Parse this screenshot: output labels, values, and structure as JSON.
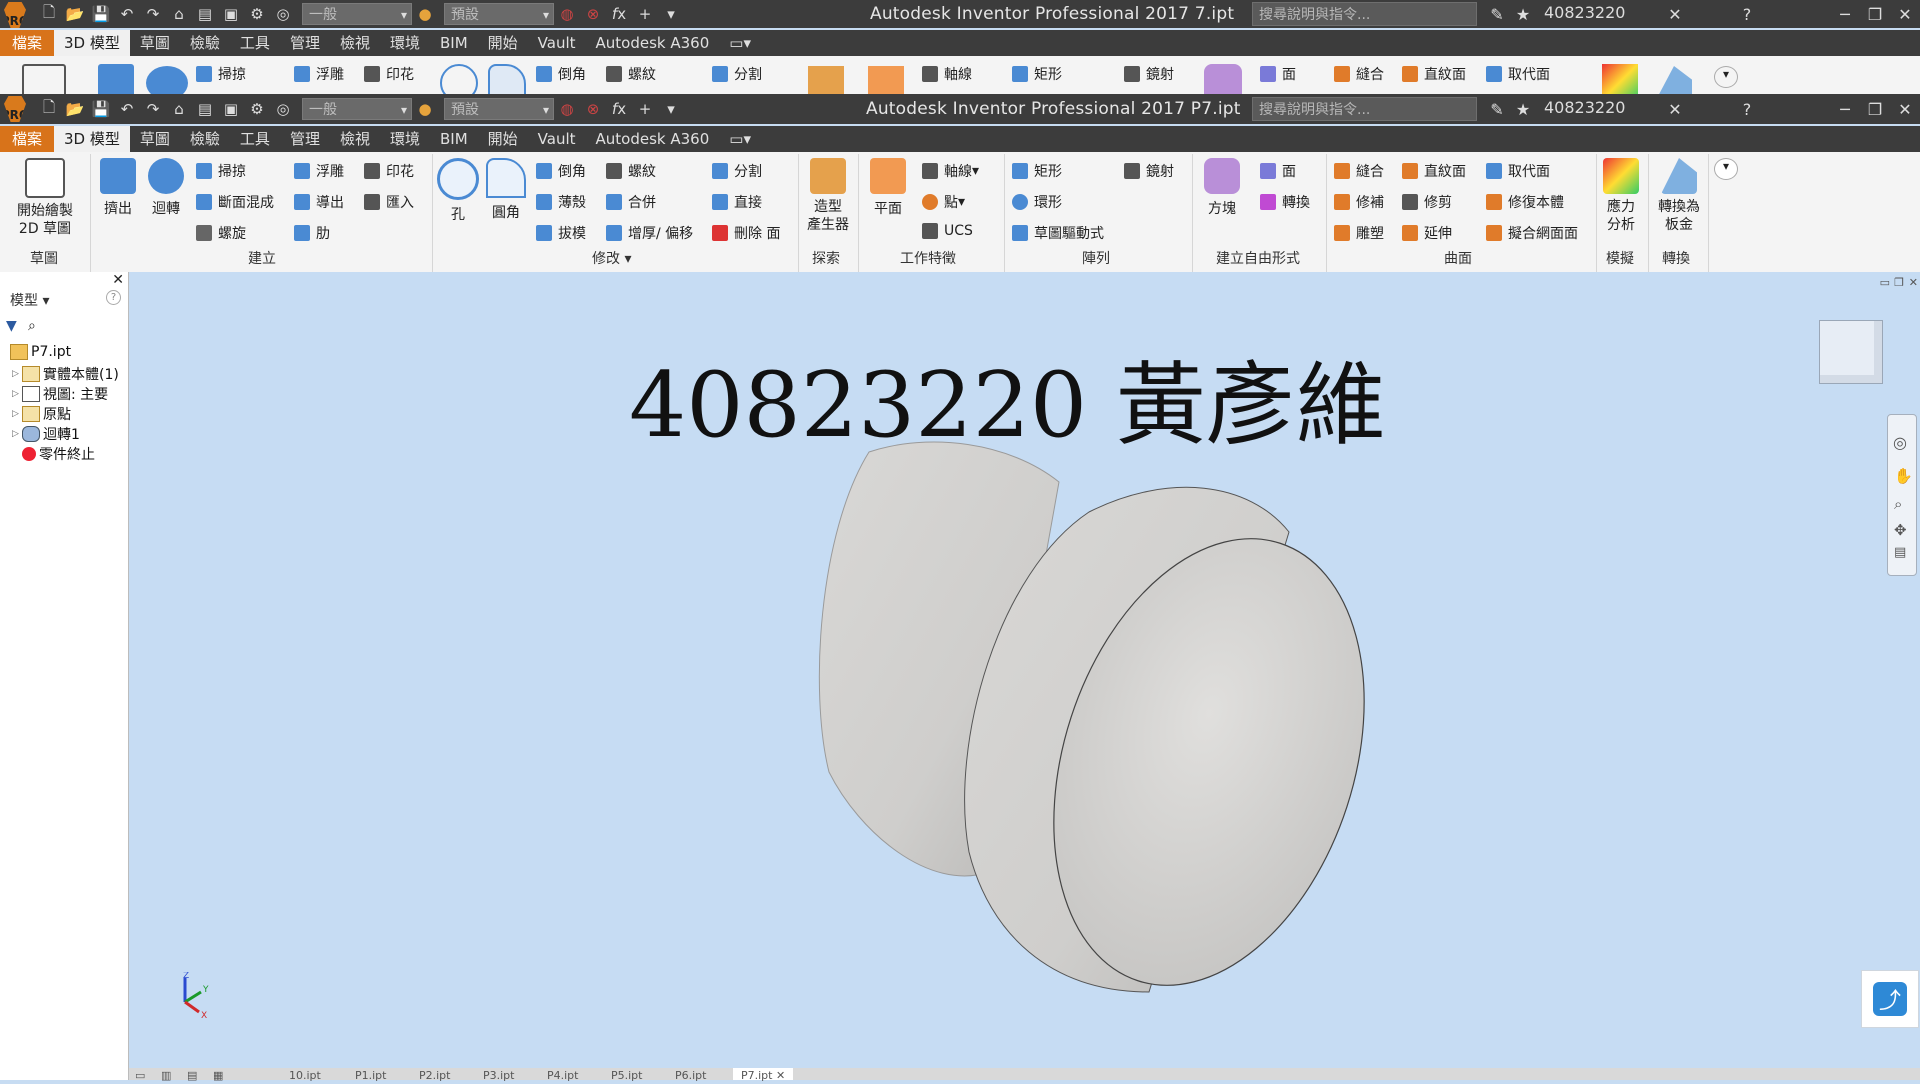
{
  "app": {
    "title_top": "Autodesk Inventor Professional 2017    7.ipt",
    "title_bottom": "Autodesk Inventor Professional 2017    P7.ipt",
    "search_placeholder": "搜尋說明與指令...",
    "user": "40823220",
    "style_dropdown": "一般",
    "appearance_dropdown": "預設"
  },
  "menu_tabs": [
    "檔案",
    "3D 模型",
    "草圖",
    "檢驗",
    "工具",
    "管理",
    "檢視",
    "環境",
    "BIM",
    "開始",
    "Vault",
    "Autodesk A360"
  ],
  "ribbon": {
    "sketch": {
      "btn": "開始繪製\n2D 草圖",
      "panel": "草圖"
    },
    "create": {
      "extrude": "擠出",
      "revolve": "迴轉",
      "sweep": "掃掠",
      "loft": "斷面混成",
      "coil": "螺旋",
      "emboss": "浮雕",
      "derive": "導出",
      "rib": "肋",
      "decal": "印花",
      "import": "匯入",
      "panel": "建立"
    },
    "modify": {
      "hole": "孔",
      "fillet": "圓角",
      "chamfer": "倒角",
      "shell": "薄殼",
      "draft": "拔模",
      "thread": "螺紋",
      "combine": "合併",
      "thicken": "增厚/ 偏移",
      "split": "分割",
      "direct": "直接",
      "delete_face": "刪除 面",
      "panel": "修改"
    },
    "explore": {
      "shape_gen": "造型\n產生器",
      "panel": "探索"
    },
    "work": {
      "plane": "平面",
      "axis": "軸線",
      "point": "點",
      "ucs": "UCS",
      "panel": "工作特徵"
    },
    "pattern": {
      "rect": "矩形",
      "circ": "環形",
      "sketch_driven": "草圖驅動式",
      "mirror": "鏡射",
      "panel": "陣列"
    },
    "freeform": {
      "box": "方塊",
      "face": "面",
      "convert": "轉換",
      "panel": "建立自由形式"
    },
    "surface": {
      "stitch": "縫合",
      "patch": "修補",
      "sculpt": "雕塑",
      "ruled": "直紋面",
      "trim": "修剪",
      "extend": "延伸",
      "replace": "取代面",
      "repair": "修復本體",
      "fit_mesh": "擬合網面面",
      "panel": "曲面"
    },
    "simulation": {
      "stress": "應力\n分析",
      "panel": "模擬"
    },
    "convert": {
      "sheet_metal": "轉換為\n板金",
      "panel": "轉換"
    }
  },
  "ribbon_top_partial": {
    "sweep": "掃掠",
    "emboss": "浮雕",
    "decal": "印花",
    "chamfer": "倒角",
    "thread": "螺紋",
    "split": "分割",
    "axis": "軸線",
    "rect": "矩形",
    "mirror": "鏡射",
    "face": "面",
    "stitch": "縫合",
    "ruled": "直紋面",
    "replace": "取代面"
  },
  "browser": {
    "header": "模型",
    "items": [
      "P7.ipt",
      "實體本體(1)",
      "視圖: 主要",
      "原點",
      "迴轉1",
      "零件終止"
    ]
  },
  "viewport": {
    "overlay_text": "40823220 黃彥維"
  },
  "doc_tabs": [
    "10.ipt",
    "P1.ipt",
    "P2.ipt",
    "P3.ipt",
    "P4.ipt",
    "P5.ipt",
    "P6.ipt",
    "P7.ipt"
  ],
  "colors": {
    "file_tab": "#d8731a",
    "titlebar": "#3c3c3c",
    "viewport_bg": "#c6dcf3"
  }
}
